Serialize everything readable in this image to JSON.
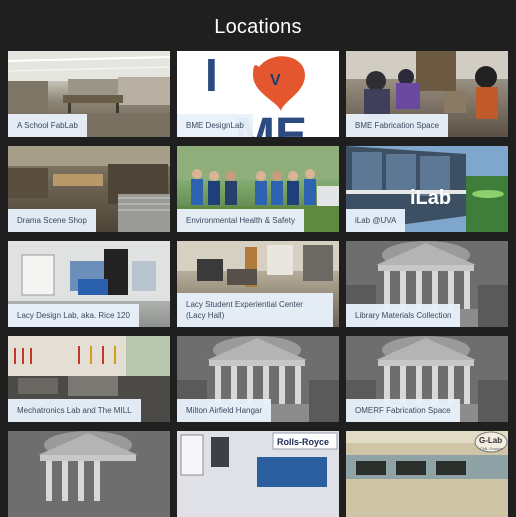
{
  "page": {
    "title": "Locations"
  },
  "tiles": [
    {
      "label": "A School FabLab",
      "photo": "fablab-workshop-photo"
    },
    {
      "label": "BME DesignLab",
      "photo": "i-heart-bme-logo-photo"
    },
    {
      "label": "BME Fabrication Space",
      "photo": "welding-space-photo"
    },
    {
      "label": "Drama Scene Shop",
      "photo": "scene-shop-photo"
    },
    {
      "label": "Environmental Health & Safety",
      "photo": "ehs-staff-photo"
    },
    {
      "label": "iLab @UVA",
      "photo": "ilab-building-photo"
    },
    {
      "label": "Lacy Design Lab, aka. Rice 120",
      "photo": "design-lab-photo"
    },
    {
      "label": "Lacy Student Experiential Center (Lacy Hall)",
      "photo": "lacy-hall-photo"
    },
    {
      "label": "Library Materials Collection",
      "photo": "rotunda-placeholder-photo"
    },
    {
      "label": "Mechatronics Lab and The MILL",
      "photo": "mechatronics-lab-photo"
    },
    {
      "label": "Milton Airfield Hangar",
      "photo": "rotunda-placeholder-photo"
    },
    {
      "label": "OMERF Fabrication Space",
      "photo": "rotunda-placeholder-photo"
    },
    {
      "label": "",
      "photo": "rotunda-placeholder-photo"
    },
    {
      "label": "",
      "photo": "rolls-royce-lab-photo",
      "sign": "Rolls-Royce"
    },
    {
      "label": "",
      "photo": "g-lab-photo",
      "sign": "G-Lab",
      "sign_sub": "CML Groups"
    }
  ],
  "bme": {
    "letter": "I",
    "logo_letter": "V",
    "bottom_text": "ME"
  },
  "ilab": {
    "sign": "iLab"
  }
}
